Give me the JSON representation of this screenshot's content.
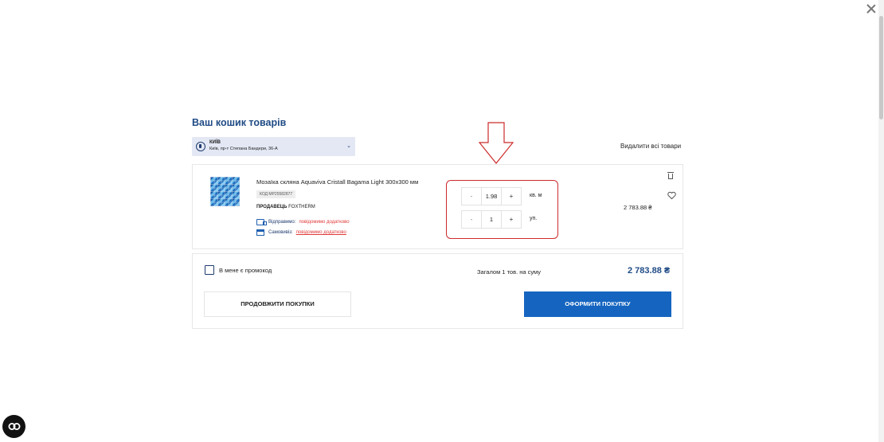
{
  "cart": {
    "title": "Ваш кошик товарів",
    "delete_all": "Видалити всі товари"
  },
  "store": {
    "city": "КИЇВ",
    "address": "Київ, пр-т Степана Бандери, 36-А"
  },
  "item": {
    "name": "Мозаїка скляна Aquaviva Cristall Bagama Light 300x300 мм",
    "code": "КОД MP25582877",
    "seller_label": "ПРОДАВЕЦЬ",
    "seller_name": "FOXTHERM",
    "ship_label": "Відправимо:",
    "ship_value": "повідомимо додатково",
    "pickup_label": "Самовивіз:",
    "pickup_value": "повідомимо додатково",
    "price": "2 783.88 ₴",
    "qty_area": {
      "minus": "-",
      "plus": "+",
      "value": "1.98",
      "unit": "кв. м"
    },
    "qty_pack": {
      "minus": "-",
      "plus": "+",
      "value": "1",
      "unit": "уп."
    }
  },
  "summary": {
    "promo_label": "В мене є промокод",
    "total_label": "Загалом 1 тов. на суму",
    "total_value": "2 783.88 ₴",
    "continue_label": "ПРОДОВЖИТИ ПОКУПКИ",
    "checkout_label": "ОФОРМИТИ ПОКУПКУ"
  },
  "colors": {
    "brand_blue": "#1565c0",
    "title_blue": "#1f4b85",
    "annotation_red": "#cc2b2b",
    "store_bg": "#e3e8f4"
  },
  "icons": [
    "close-icon",
    "store-location-icon",
    "chevron-down-icon",
    "truck-icon",
    "store-pickup-icon",
    "trash-icon",
    "heart-icon",
    "accessibility-icon",
    "down-arrow-annotation"
  ]
}
